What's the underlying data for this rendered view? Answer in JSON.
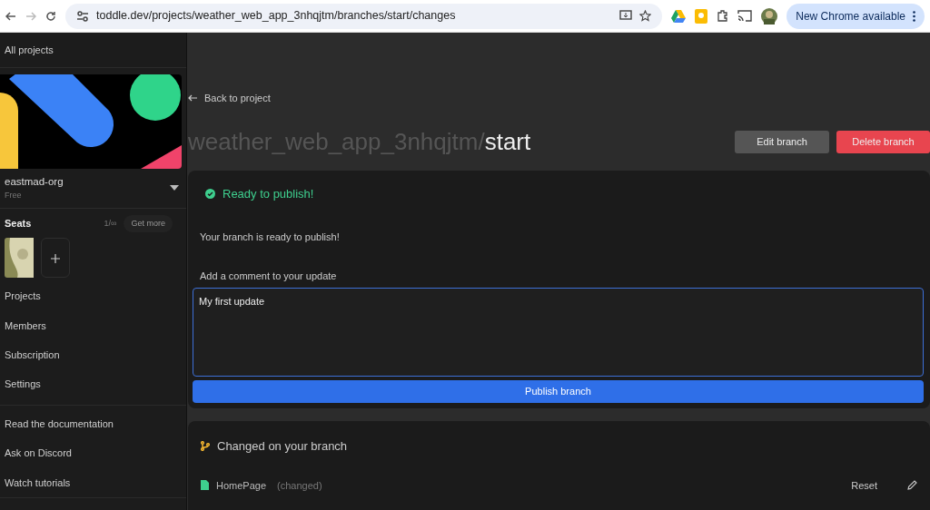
{
  "browser": {
    "url": "toddle.dev/projects/weather_web_app_3nhqjtm/branches/start/changes",
    "update_button": "New Chrome available"
  },
  "sidebar": {
    "all_projects": "All projects",
    "org": {
      "name": "eastmad-org",
      "plan": "Free"
    },
    "seats": {
      "title": "Seats",
      "count": "1/∞",
      "get_more": "Get more"
    },
    "nav": [
      "Projects",
      "Members",
      "Subscription",
      "Settings"
    ],
    "links": [
      "Read the documentation",
      "Ask on Discord",
      "Watch tutorials"
    ]
  },
  "main": {
    "back_link": "Back to project",
    "title": {
      "project": "weather_web_app_3nhqjtm/",
      "branch": "start"
    },
    "buttons": [
      {
        "label": "Edit branch",
        "kind": "secondary"
      },
      {
        "label": "Delete branch",
        "kind": "danger"
      }
    ],
    "publish_card": {
      "status": "Ready to publish!",
      "message": "Your branch is ready to publish!",
      "comment_label": "Add a comment to your update",
      "comment_value": "My first update",
      "publish_button": "Publish branch"
    },
    "changes_card": {
      "title": "Changed on your branch",
      "items": [
        {
          "name": "HomePage",
          "note": "(changed)",
          "action": "Reset"
        }
      ]
    }
  }
}
